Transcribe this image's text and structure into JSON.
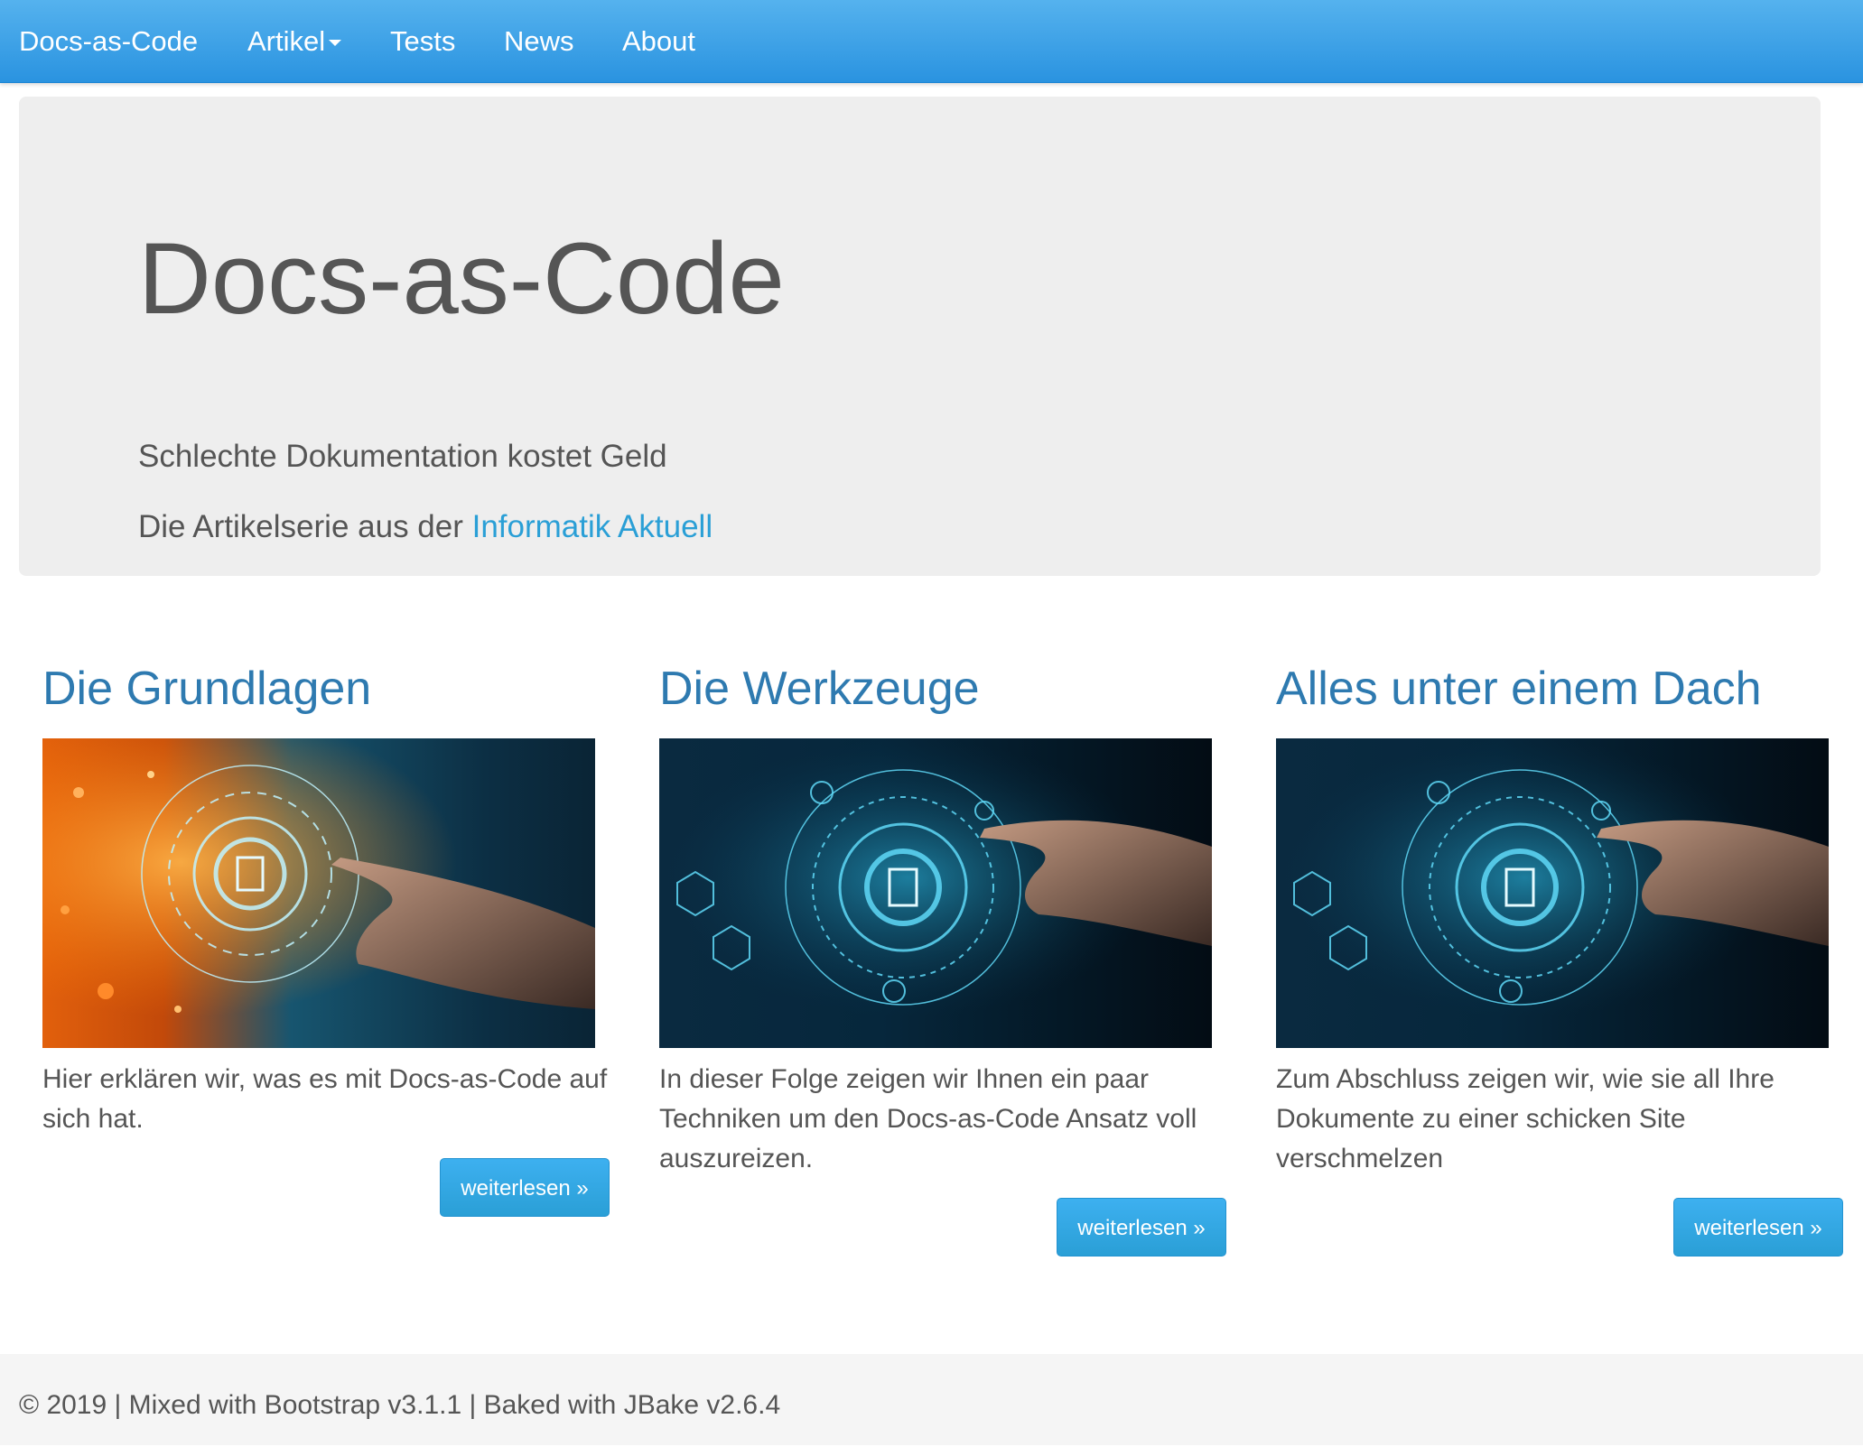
{
  "navbar": {
    "brand": "Docs-as-Code",
    "items": [
      {
        "label": "Artikel",
        "has_dropdown": true
      },
      {
        "label": "Tests"
      },
      {
        "label": "News"
      },
      {
        "label": "About"
      }
    ]
  },
  "jumbotron": {
    "title": "Docs-as-Code",
    "lead": "Schlechte Dokumentation kostet Geld",
    "series_prefix": "Die Artikelserie aus der ",
    "series_link": "Informatik Aktuell"
  },
  "articles": [
    {
      "title": "Die Grundlagen",
      "text": "Hier erklären wir, was es mit Docs-as-Code auf sich hat.",
      "button": "weiterlesen »",
      "image_theme": "orange"
    },
    {
      "title": "Die Werkzeuge",
      "text": "In dieser Folge zeigen wir Ihnen ein paar Techniken um den Docs-as-Code Ansatz voll auszureizen.",
      "button": "weiterlesen »",
      "image_theme": "blue"
    },
    {
      "title": "Alles unter einem Dach",
      "text": "Zum Abschluss zeigen wir, wie sie all Ihre Dokumente zu einer schicken Site verschmelzen",
      "button": "weiterlesen »",
      "image_theme": "blue"
    }
  ],
  "footer": {
    "text": "© 2019 | Mixed with Bootstrap v3.1.1 | Baked with JBake v2.6.4"
  },
  "colors": {
    "navbar": "#2a9fd6",
    "link": "#2a9fd6",
    "heading": "#2e7ab0",
    "jumbotron_bg": "#eeeeee",
    "text": "#555555"
  }
}
